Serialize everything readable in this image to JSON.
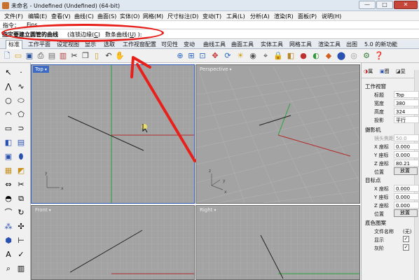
{
  "window": {
    "title": "未命名 - Undefined (Undefined) (64-bit)",
    "minimize": "—",
    "maximize": "□",
    "close": "✕"
  },
  "menu": [
    "文件(F)",
    "编辑(E)",
    "查看(V)",
    "曲线(C)",
    "曲面(S)",
    "实体(O)",
    "网格(M)",
    "尺寸标注(D)",
    "变动(T)",
    "工具(L)",
    "分析(A)",
    "渲染(R)",
    "面板(P)",
    "说明(H)"
  ],
  "command": {
    "history_label": "指令：",
    "history_value": "_Fins",
    "prompt": "指定要建立圆管的曲线",
    "option1": "连锁边缘",
    "option1_key": "C",
    "option2": "数条曲线",
    "option2_key": "U"
  },
  "tabs": [
    "标准",
    "工作平面",
    "设定视图",
    "显示",
    "选取",
    "工作视窗配置",
    "可见性",
    "变动",
    "曲线工具",
    "曲面工具",
    "实体工具",
    "网格工具",
    "渲染工具",
    "出图",
    "5.0 的新功能"
  ],
  "active_tab": "标准",
  "toolbar_icons": [
    "new-file-icon",
    "open-folder-icon",
    "save-icon",
    "print-icon",
    "import-icon",
    "cut-icon",
    "copy-icon",
    "paste-icon",
    "undo-icon",
    "pan-hand-icon",
    "rotate-view-icon",
    "zoom-icon",
    "zoom-window-icon",
    "zoom-extents-icon",
    "zoom-selected-icon",
    "cplane-icon",
    "camera-icon",
    "lock-icon",
    "properties-icon",
    "layer-icon",
    "point-icon",
    "color-icon",
    "render-icon",
    "sphere-icon",
    "light-icon",
    "material-icon",
    "gear-icon",
    "help-icon"
  ],
  "viewports": {
    "top": "Top",
    "perspective": "Perspective",
    "front": "Front",
    "right": "Right"
  },
  "panel": {
    "tab1": "属",
    "tab2": "图",
    "tab3": "显",
    "viewport_section": "工作视窗",
    "title_label": "标题",
    "title_value": "Top",
    "width_label": "宽度",
    "width_value": "380",
    "height_label": "高度",
    "height_value": "324",
    "projection_label": "投影",
    "projection_value": "平行",
    "camera_section": "摄影机",
    "lens_label": "镜头焦距",
    "lens_value": "50.0",
    "x_label": "X 座标",
    "x_value": "0.000",
    "y_label": "Y 座标",
    "y_value": "0.000",
    "z_label": "Z 座标",
    "z_value": "80.21",
    "position_label": "位置",
    "position_btn": "放置",
    "target_section": "目标点",
    "tx_label": "X 座标",
    "tx_value": "0.000",
    "ty_label": "Y 座标",
    "ty_value": "0.000",
    "tz_label": "Z 座标",
    "tz_value": "0.000",
    "tposition_label": "位置",
    "tposition_btn": "放置",
    "bg_section": "底色图案",
    "filename_label": "文件名称",
    "filename_value": "(无)",
    "show_label": "显示",
    "gray_label": "灰阶"
  }
}
